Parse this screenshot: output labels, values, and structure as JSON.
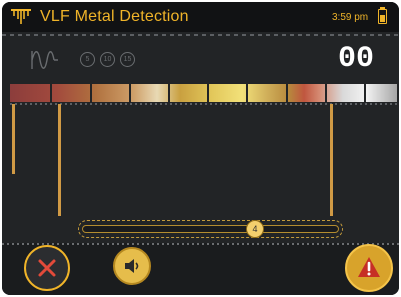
{
  "app": {
    "title": "VLF Metal Detection",
    "time": "3:59 pm",
    "battery_level": 0.6,
    "accent_color": "#f0b429"
  },
  "header": {
    "logo_icon": "trident-coil-icon",
    "battery_icon": "battery-icon"
  },
  "mode": {
    "waveform_icon": "sine-wave-icon",
    "depth_options": [
      "5",
      "10",
      "15"
    ],
    "readout": "00"
  },
  "slider": {
    "value": "4"
  },
  "buttons": {
    "close_icon": "close-icon",
    "sound_icon": "speaker-icon",
    "alert_icon": "warning-icon"
  }
}
